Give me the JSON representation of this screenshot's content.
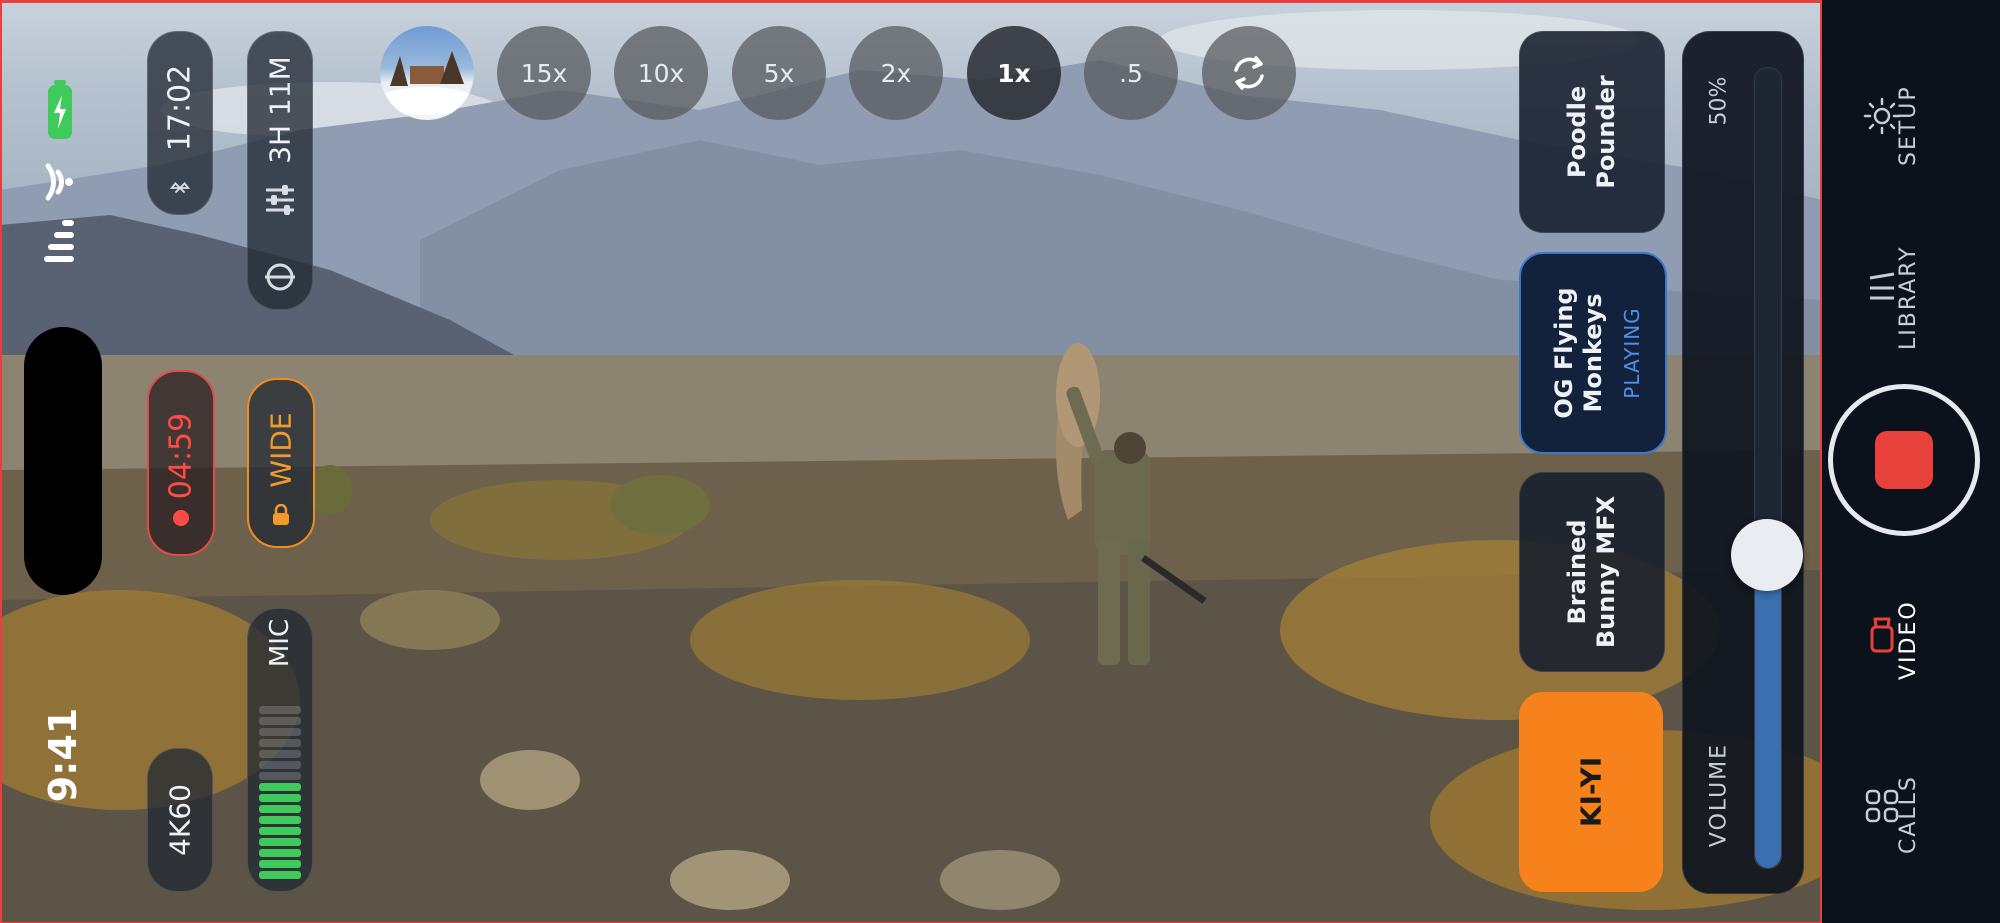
{
  "status_bar": {
    "time": "9:41"
  },
  "top_left": {
    "clock": "17:02",
    "battery_time": "3H 11M",
    "recording_timer": "04:59",
    "lens": "WIDE",
    "mic_label": "MIC",
    "mic_level": 0.55,
    "resolution": "4K60"
  },
  "zoom": {
    "levels": [
      "15x",
      "10x",
      "5x",
      "2x",
      "1x",
      ".5"
    ],
    "selected": "1x"
  },
  "sound_cards": [
    {
      "title": "Poodle\nPounder",
      "status": ""
    },
    {
      "title": "OG Flying\nMonkeys",
      "status": "PLAYING"
    },
    {
      "title": "Brained\nBunny MFX",
      "status": ""
    },
    {
      "title": "KI-YI",
      "status": ""
    }
  ],
  "volume": {
    "label": "VOLUME",
    "value_text": "50%",
    "level": 0.5
  },
  "nav": {
    "setup": "SETUP",
    "library": "LIBRARY",
    "video": "VIDEO",
    "calls": "CALLS"
  },
  "colors": {
    "accent_record": "#e8403a",
    "accent_orange": "#f7811a",
    "accent_blue": "#3d79c9",
    "nav_bg": "#0c121c"
  },
  "icons": [
    "bluetooth-icon",
    "sliders-icon",
    "lock-icon",
    "rotate-camera-icon",
    "gear-icon",
    "library-icon",
    "video-camera-icon",
    "calls-grid-icon",
    "record-stop-icon"
  ]
}
